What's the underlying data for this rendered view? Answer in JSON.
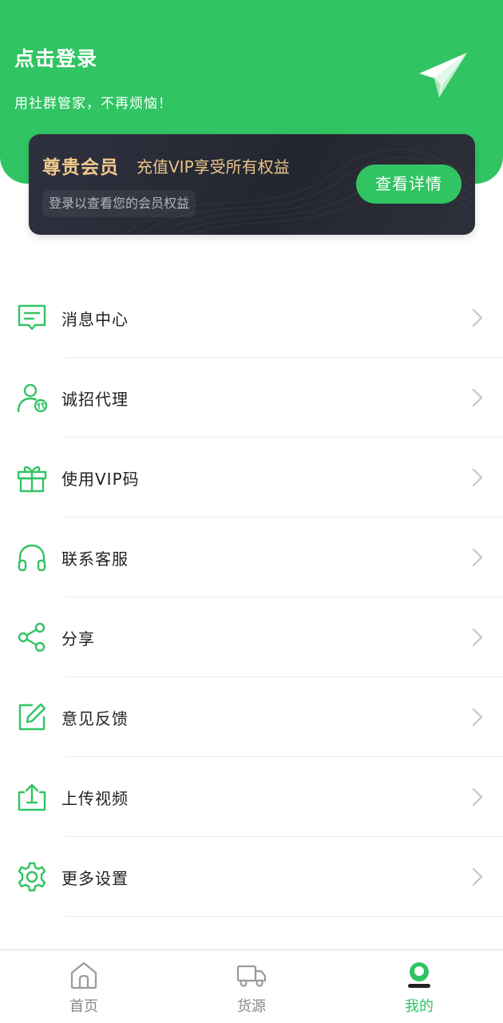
{
  "header": {
    "title": "点击登录",
    "subtitle": "用社群管家，不再烦恼！",
    "icon": "paper-plane-icon"
  },
  "vip_card": {
    "title": "尊贵会员",
    "description": "充值VIP享受所有权益",
    "hint": "登录以查看您的会员权益",
    "button_label": "查看详情"
  },
  "menu": {
    "items": [
      {
        "label": "消息中心",
        "icon": "message-icon"
      },
      {
        "label": "诚招代理",
        "icon": "agent-icon"
      },
      {
        "label": "使用VIP码",
        "icon": "gift-icon"
      },
      {
        "label": "联系客服",
        "icon": "headset-icon"
      },
      {
        "label": "分享",
        "icon": "share-icon"
      },
      {
        "label": "意见反馈",
        "icon": "feedback-icon"
      },
      {
        "label": "上传视频",
        "icon": "upload-icon"
      },
      {
        "label": "更多设置",
        "icon": "settings-icon"
      }
    ]
  },
  "tabbar": {
    "tabs": [
      {
        "label": "首页",
        "icon": "home-icon"
      },
      {
        "label": "货源",
        "icon": "truck-icon"
      },
      {
        "label": "我的",
        "icon": "profile-icon"
      }
    ],
    "active": "我的"
  },
  "colors": {
    "brand": "#31c463",
    "vip_gold": "#f1c98b",
    "card_dark": "#2a2c36",
    "inactive": "#888888"
  }
}
